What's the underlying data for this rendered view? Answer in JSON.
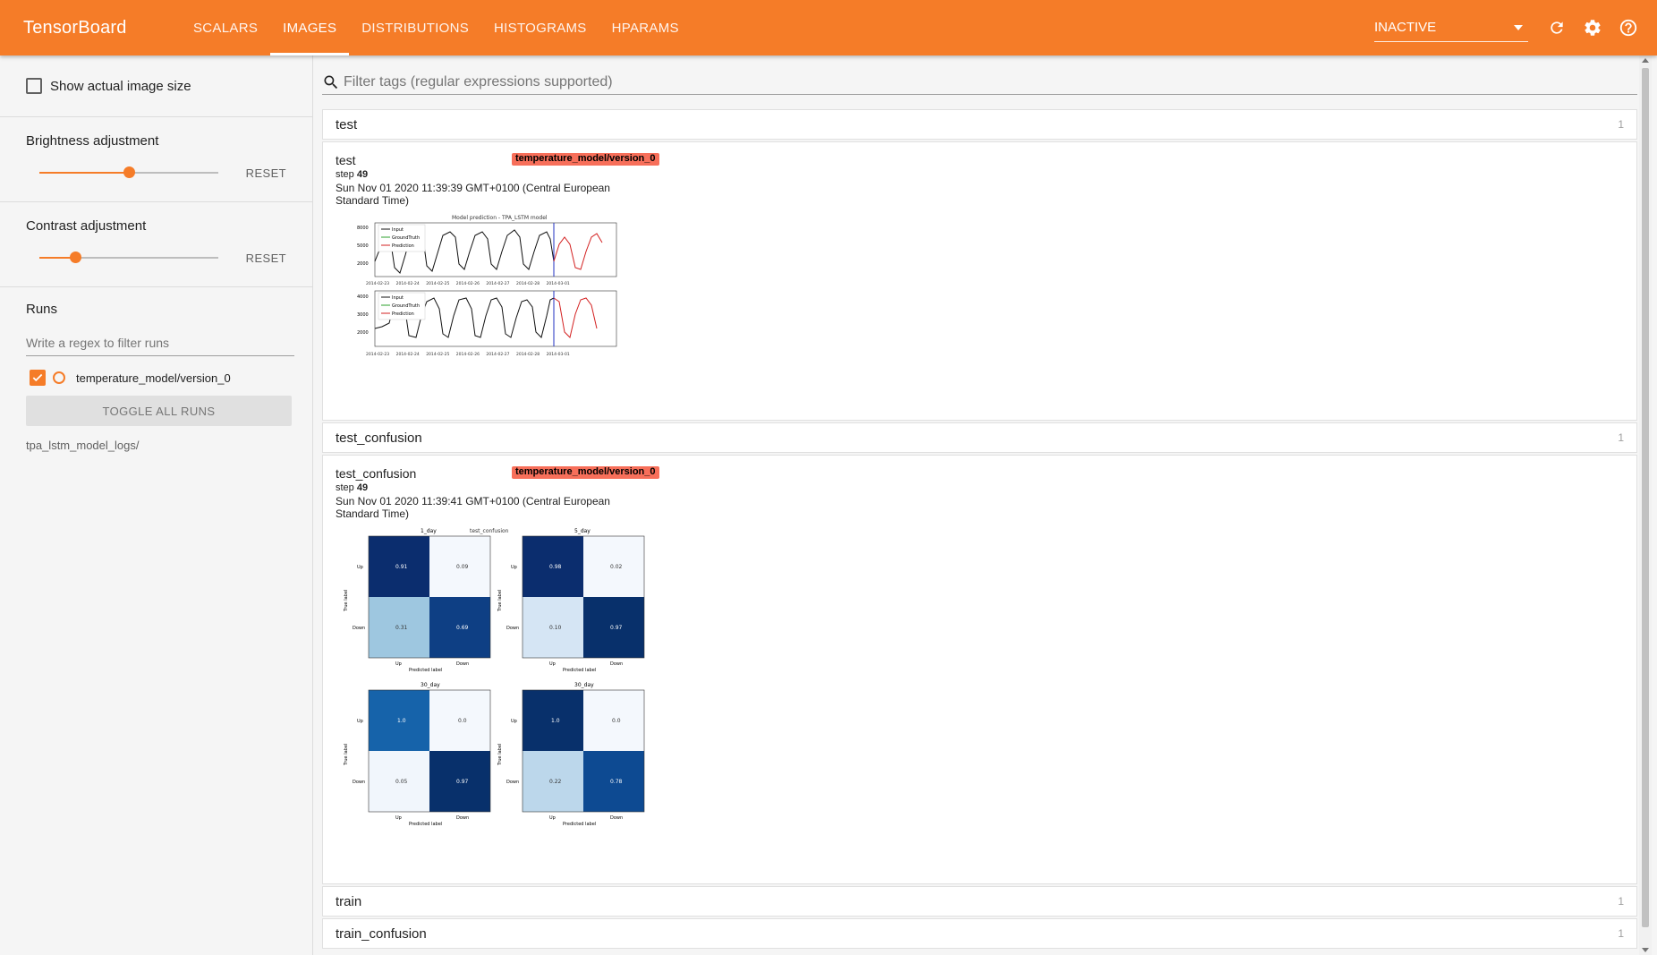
{
  "app": {
    "brand": "TensorBoard",
    "tabs": [
      {
        "label": "SCALARS"
      },
      {
        "label": "IMAGES"
      },
      {
        "label": "DISTRIBUTIONS"
      },
      {
        "label": "HISTOGRAMS"
      },
      {
        "label": "HPARAMS"
      }
    ],
    "active_tab": "IMAGES",
    "reload_status": "INACTIVE",
    "accent_color": "#f57c28",
    "icons": [
      "refresh-icon",
      "settings-icon",
      "help-icon"
    ]
  },
  "sidebar": {
    "show_actual_size_label": "Show actual image size",
    "show_actual_size_checked": false,
    "brightness": {
      "label": "Brightness adjustment",
      "reset_label": "RESET",
      "value_fraction": 0.5
    },
    "contrast": {
      "label": "Contrast adjustment",
      "reset_label": "RESET",
      "value_fraction": 0.2
    },
    "runs": {
      "title": "Runs",
      "filter_placeholder": "Write a regex to filter runs",
      "items": [
        {
          "name": "temperature_model/version_0",
          "checked": true,
          "color": "#f57c28"
        }
      ],
      "toggle_all_label": "TOGGLE ALL RUNS",
      "logdir": "tpa_lstm_model_logs/"
    }
  },
  "main": {
    "tag_filter_placeholder": "Filter tags (regular expressions supported)",
    "categories": [
      {
        "name": "test",
        "count": "1",
        "card": {
          "title": "test",
          "run": "temperature_model/version_0",
          "step_label": "step",
          "step": "49",
          "timestamp": "Sun Nov 01 2020 11:39:39 GMT+0100 (Central European Standard Time)",
          "image_title": "Model prediction - TPA_LSTM model",
          "legend": [
            "Input",
            "GroundTruth",
            "Prediction"
          ],
          "y_ticks_top": [
            "8000",
            "5000",
            "2000"
          ],
          "y_ticks_bottom": [
            "4000",
            "3000",
            "2000"
          ],
          "x_ticks": [
            "2014-02-23",
            "2014-02-24",
            "2014-02-25",
            "2014-02-26",
            "2014-02-27",
            "2014-02-28",
            "2014-03-01"
          ]
        }
      },
      {
        "name": "test_confusion",
        "count": "1",
        "card": {
          "title": "test_confusion",
          "run": "temperature_model/version_0",
          "step_label": "step",
          "step": "49",
          "timestamp": "Sun Nov 01 2020 11:39:41 GMT+0100 (Central European Standard Time)",
          "suptitle": "test_confusion",
          "x_axis_label": "Predicted label",
          "y_axis_label": "True label",
          "class_labels": [
            "Up",
            "Down"
          ],
          "matrices": [
            {
              "title": "1_day",
              "values": [
                "0.91",
                "0.09",
                "0.31",
                "0.69"
              ]
            },
            {
              "title": "5_day",
              "values": [
                "0.98",
                "0.02",
                "0.10",
                "0.97"
              ]
            },
            {
              "title": "30_day",
              "values": [
                "1.0",
                "0.0",
                "0.05",
                "0.97"
              ]
            },
            {
              "title": "30_day",
              "values": [
                "1.0",
                "0.0",
                "0.22",
                "0.78"
              ]
            }
          ]
        }
      },
      {
        "name": "train",
        "count": "1"
      },
      {
        "name": "train_confusion",
        "count": "1"
      }
    ]
  }
}
